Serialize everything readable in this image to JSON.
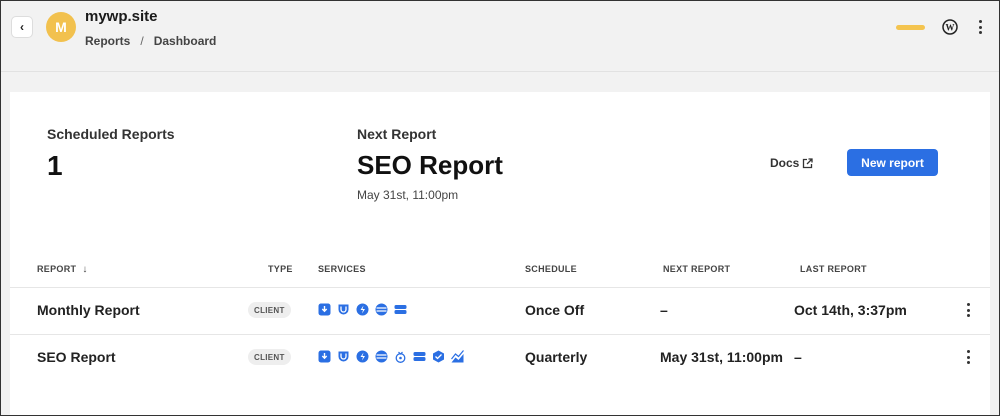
{
  "header": {
    "back_icon": "chevron-left-icon",
    "avatar_letter": "M",
    "site_title": "mywp.site",
    "breadcrumb": [
      "Reports",
      "Dashboard"
    ],
    "breadcrumb_sep": "/",
    "colors": {
      "avatar": "#f2c14e",
      "status_pill": "#f4c44f"
    }
  },
  "summary": {
    "scheduled_label": "Scheduled Reports",
    "scheduled_count": "1",
    "next_label": "Next Report",
    "next_name": "SEO Report",
    "next_date": "May 31st, 11:00pm"
  },
  "actions": {
    "docs_label": "Docs",
    "new_report_label": "New report",
    "accent": "#2b6fe3"
  },
  "table": {
    "columns": [
      "REPORT",
      "TYPE",
      "SERVICES",
      "SCHEDULE",
      "NEXT REPORT",
      "LAST REPORT"
    ],
    "rows": [
      {
        "report": "Monthly Report",
        "type": "CLIENT",
        "services": [
          "backup-icon",
          "security-icon",
          "performance-icon",
          "uptime-icon",
          "hosting-icon"
        ],
        "schedule": "Once Off",
        "next_report": "–",
        "last_report": "Oct 14th, 3:37pm"
      },
      {
        "report": "SEO Report",
        "type": "CLIENT",
        "services": [
          "backup-icon",
          "security-icon",
          "performance-icon",
          "uptime-icon",
          "analytics-icon",
          "hosting-icon",
          "seo-icon",
          "traffic-icon"
        ],
        "schedule": "Quarterly",
        "next_report": "May 31st, 11:00pm",
        "last_report": "–"
      }
    ]
  }
}
